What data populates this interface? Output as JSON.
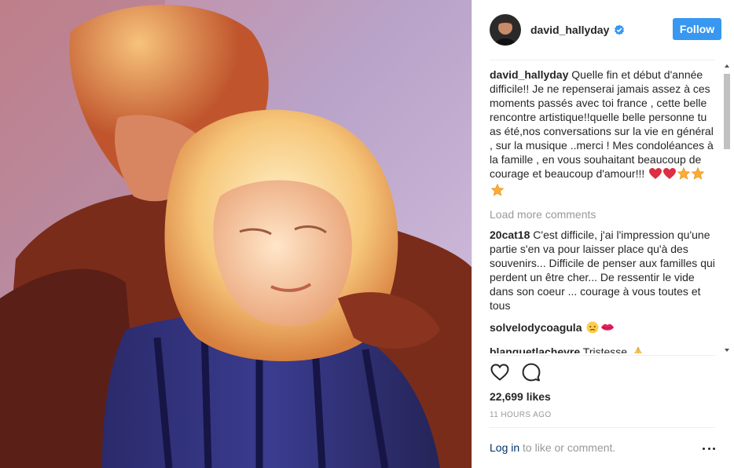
{
  "post": {
    "username": "david_hallyday",
    "follow_label": "Follow",
    "caption": {
      "user": "david_hallyday",
      "text": "Quelle fin et début d'année difficile!! Je ne repenserai jamais assez à ces moments passés avec toi france , cette belle rencontre artistique!!quelle belle personne tu as été,nos conversations sur la vie en général , sur la musique ..merci ! Mes condoléances à la famille , en vous souhaitant beaucoup de courage et beaucoup d'amour!!!",
      "emojis": [
        "red-heart",
        "red-heart",
        "star",
        "star",
        "star"
      ]
    },
    "load_more": "Load more comments",
    "comments": [
      {
        "user": "20cat18",
        "text": "C'est difficile, j'ai l'impression qu'une partie s'en va pour laisser place qu'à des souvenirs... Difficile de penser aux familles qui perdent un être cher... De ressentir le vide dans son coeur ... courage à vous toutes et tous"
      },
      {
        "user": "solvelodycoagula",
        "text": "",
        "emojis": [
          "disappointed-face",
          "kiss-lips"
        ]
      },
      {
        "user": "blanquetlachevre",
        "text": "Tristesse",
        "emojis": [
          "folded-hands"
        ]
      }
    ],
    "likes": "22,699 likes",
    "time": "11 hours ago",
    "footer": {
      "login": "Log in",
      "rest": "to like or comment."
    },
    "icons": [
      "verified-badge-icon",
      "heart-icon",
      "comment-icon",
      "more-options-icon"
    ],
    "colors": {
      "accent": "#3897f0",
      "link": "#003569",
      "muted": "#999999"
    }
  }
}
